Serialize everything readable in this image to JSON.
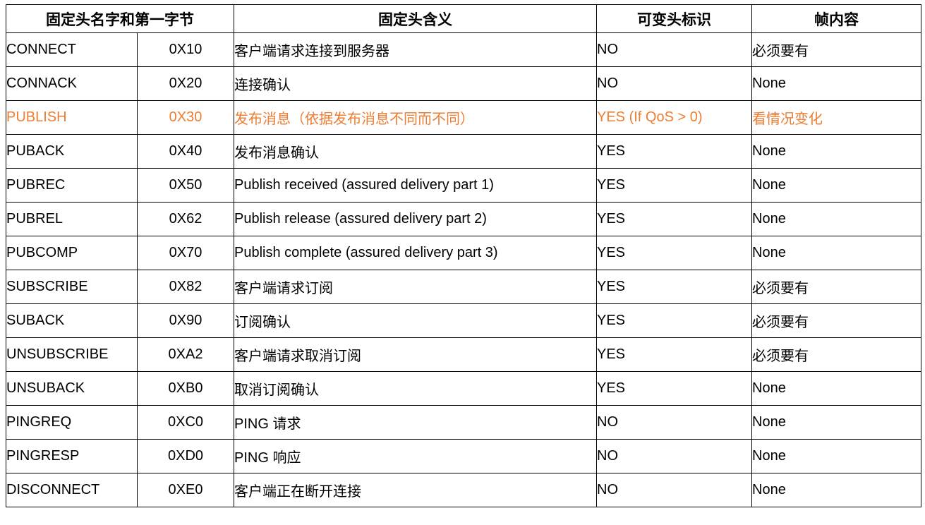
{
  "colors": {
    "border": "#000000",
    "text": "#000000",
    "highlight": "#ED7D31"
  },
  "headers": {
    "name_and_byte": "固定头名字和第一字节",
    "meaning": "固定头含义",
    "variable_header_flag": "可变头标识",
    "payload": "帧内容"
  },
  "rows": [
    {
      "name": "CONNECT",
      "code": "0X10",
      "meaning": "客户端请求连接到服务器",
      "flag": "NO",
      "payload": "必须要有",
      "highlight": false
    },
    {
      "name": "CONNACK",
      "code": "0X20",
      "meaning": "连接确认",
      "flag": "NO",
      "payload": "None",
      "highlight": false
    },
    {
      "name": "PUBLISH",
      "code": "0X30",
      "meaning": "发布消息（依据发布消息不同而不同）",
      "flag": "YES (If QoS > 0)",
      "payload": "看情况变化",
      "highlight": true
    },
    {
      "name": "PUBACK",
      "code": "0X40",
      "meaning": "发布消息确认",
      "flag": "YES",
      "payload": "None",
      "highlight": false
    },
    {
      "name": "PUBREC",
      "code": "0X50",
      "meaning": "Publish received (assured delivery part 1)",
      "flag": "YES",
      "payload": "None",
      "highlight": false
    },
    {
      "name": "PUBREL",
      "code": "0X62",
      "meaning": "Publish release (assured delivery part 2)",
      "flag": "YES",
      "payload": "None",
      "highlight": false
    },
    {
      "name": "PUBCOMP",
      "code": "0X70",
      "meaning": "Publish complete (assured delivery part 3)",
      "flag": "YES",
      "payload": "None",
      "highlight": false
    },
    {
      "name": "SUBSCRIBE",
      "code": "0X82",
      "meaning": "客户端请求订阅",
      "flag": "YES",
      "payload": "必须要有",
      "highlight": false
    },
    {
      "name": "SUBACK",
      "code": "0X90",
      "meaning": "订阅确认",
      "flag": "YES",
      "payload": "必须要有",
      "highlight": false
    },
    {
      "name": "UNSUBSCRIBE",
      "code": "0XA2",
      "meaning": "客户端请求取消订阅",
      "flag": "YES",
      "payload": "必须要有",
      "highlight": false
    },
    {
      "name": "UNSUBACK",
      "code": "0XB0",
      "meaning": "取消订阅确认",
      "flag": "YES",
      "payload": "None",
      "highlight": false
    },
    {
      "name": "PINGREQ",
      "code": "0XC0",
      "meaning": "PING 请求",
      "flag": "NO",
      "payload": "None",
      "highlight": false
    },
    {
      "name": "PINGRESP",
      "code": "0XD0",
      "meaning": "PING 响应",
      "flag": "NO",
      "payload": "None",
      "highlight": false
    },
    {
      "name": "DISCONNECT",
      "code": "0XE0",
      "meaning": "客户端正在断开连接",
      "flag": "NO",
      "payload": "None",
      "highlight": false
    }
  ]
}
